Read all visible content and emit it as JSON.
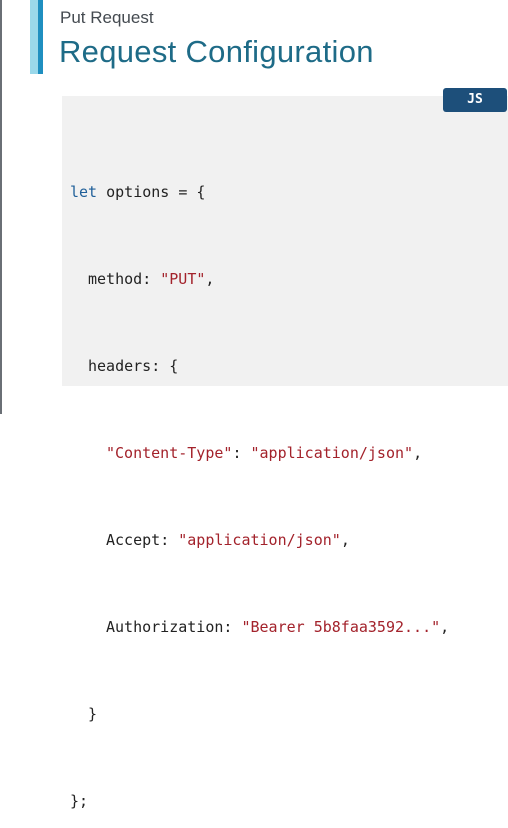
{
  "slide": {
    "subtitle": "Put Request",
    "title": "Request Configuration"
  },
  "badge": {
    "label": "JS"
  },
  "code": {
    "line1": {
      "keyword": "let",
      "rest": " options = {"
    },
    "line2": {
      "key": "method",
      "sep": ": ",
      "value": "\"PUT\"",
      "end": ","
    },
    "line3": {
      "key": "headers",
      "sep": ": ",
      "rest": "{"
    },
    "line4": {
      "key": "\"Content-Type\"",
      "sep": ": ",
      "value": "\"application/json\"",
      "end": ","
    },
    "line5": {
      "key": "Accept",
      "sep": ": ",
      "value": "\"application/json\"",
      "end": ","
    },
    "line6": {
      "key": "Authorization",
      "sep": ": ",
      "value": "\"Bearer 5b8faa3592...\"",
      "end": ","
    },
    "line7": {
      "text": "}"
    },
    "line8": {
      "text": "};"
    }
  },
  "colors": {
    "title": "#1e6b87",
    "accent_light": "#9ad8ea",
    "accent_dark": "#1f8fc0",
    "badge_bg": "#1d4f7a",
    "code_bg": "#f1f1f1",
    "string": "#a3222b",
    "keyword": "#1f5f99"
  }
}
